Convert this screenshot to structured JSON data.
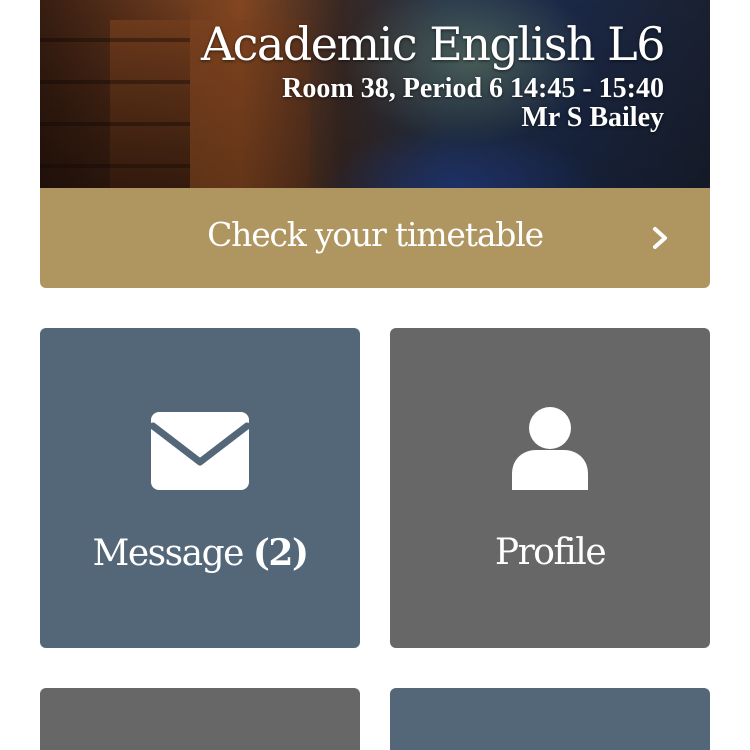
{
  "lesson": {
    "title": "Academic English L6",
    "room_period_time": "Room 38, Period 6 14:45 - 15:40",
    "teacher": "Mr S Bailey"
  },
  "timetable": {
    "label": "Check your timetable",
    "icon": "chevron-right-icon"
  },
  "tiles": [
    {
      "label": "Message",
      "count": "(2)",
      "icon": "envelope-icon",
      "color": "#546779"
    },
    {
      "label": "Profile",
      "icon": "user-icon",
      "color": "#676767"
    },
    {
      "color": "#676767"
    },
    {
      "color": "#546779"
    }
  ],
  "colors": {
    "timetable_bar": "#af9660",
    "tile_blue": "#546779",
    "tile_grey": "#676767"
  }
}
